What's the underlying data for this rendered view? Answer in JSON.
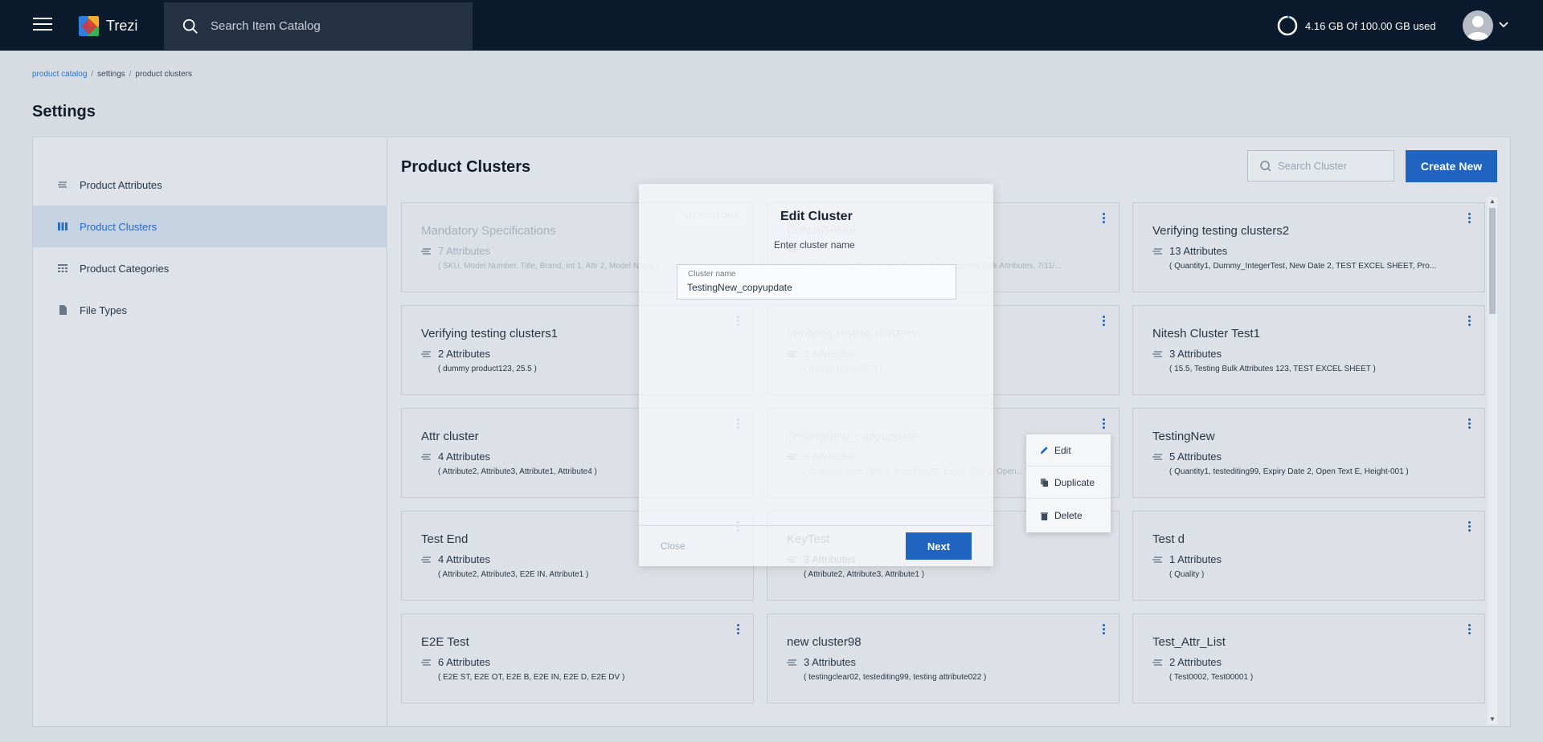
{
  "app": {
    "name": "Trezi"
  },
  "header": {
    "search_placeholder": "Search Item Catalog",
    "storage_text": "4.16 GB Of 100.00 GB used",
    "storage_used_fraction": 0.0416
  },
  "breadcrumb": [
    "product catalog",
    "settings",
    "product clusters"
  ],
  "page_title": "Settings",
  "sidebar": {
    "items": [
      {
        "label": "Product Attributes",
        "icon": "attributes-icon",
        "active": false
      },
      {
        "label": "Product Clusters",
        "icon": "clusters-icon",
        "active": true
      },
      {
        "label": "Product Categories",
        "icon": "categories-icon",
        "active": false
      },
      {
        "label": "File Types",
        "icon": "file-icon",
        "active": false
      }
    ]
  },
  "content": {
    "title": "Product Clusters",
    "search_placeholder": "Search Cluster",
    "create_label": "Create New"
  },
  "clusters": [
    {
      "name": "Mandatory Specifications",
      "count": "7 Attributes",
      "attrs": "( SKU, Model Number, Title, Brand, Int 1, Attr 2, Model Name )",
      "badge": "MANDATORY"
    },
    {
      "name": "DoNotDelete",
      "count": "",
      "attrs": "( 15, Dummy_Short, 12.5, Dummy_Open, Testing Bulk Attributes, 7/11/..."
    },
    {
      "name": "Verifying testing clusters2",
      "count": "13 Attributes",
      "attrs": "( Quantity1, Dummy_IntegerTest, New Date 2, TEST EXCEL SHEET, Pro..."
    },
    {
      "name": "Verifying testing clusters1",
      "count": "2 Attributes",
      "attrs": "( dummy product123, 25.5 )"
    },
    {
      "name": "Verifying testing clusters",
      "count": "1 Attributes",
      "attrs": "( dummy product123 )"
    },
    {
      "name": "Nitesh Cluster Test1",
      "count": "3 Attributes",
      "attrs": "( 15.5, Testing Bulk Attributes 123, TEST EXCEL SHEET )"
    },
    {
      "name": "Attr cluster",
      "count": "4 Attributes",
      "attrs": "( Attribute2, Attribute3, Attribute1, Attribute4 )"
    },
    {
      "name": "TestingNew_copyupdate",
      "count": "6 Attributes",
      "attrs": "( Quantity1, New Date 2, testediting99, Expiry Date 2, Open..."
    },
    {
      "name": "TestingNew",
      "count": "5 Attributes",
      "attrs": "( Quantity1, testediting99, Expiry Date 2, Open Text E, Height-001 )"
    },
    {
      "name": "Test End",
      "count": "4 Attributes",
      "attrs": "( Attribute2, Attribute3, E2E IN, Attribute1 )"
    },
    {
      "name": "KeyTest",
      "count": "3 Attributes",
      "attrs": "( Attribute2, Attribute3, Attribute1 )"
    },
    {
      "name": "Test d",
      "count": "1 Attributes",
      "attrs": "( Quality )"
    },
    {
      "name": "E2E Test",
      "count": "6 Attributes",
      "attrs": "( E2E ST, E2E OT, E2E B, E2E IN, E2E D, E2E DV )"
    },
    {
      "name": "new cluster98",
      "count": "3 Attributes",
      "attrs": "( testingclear02, testediting99, testing attribute022 )"
    },
    {
      "name": "Test_Attr_List",
      "count": "2 Attributes",
      "attrs": "( Test0002, Test00001 )"
    }
  ],
  "modal": {
    "title": "Edit Cluster",
    "subtitle": "Enter cluster name",
    "field_label": "Cluster name",
    "field_value": "TestingNew_copyupdate",
    "close_label": "Close",
    "next_label": "Next"
  },
  "context_menu": {
    "items": [
      {
        "label": "Edit",
        "icon": "pencil-icon"
      },
      {
        "label": "Duplicate",
        "icon": "duplicate-icon"
      },
      {
        "label": "Delete",
        "icon": "trash-icon"
      }
    ]
  },
  "colors": {
    "header_bg": "#0b1a2c",
    "accent": "#1f64c1",
    "active_bg": "#c6d3e3"
  }
}
